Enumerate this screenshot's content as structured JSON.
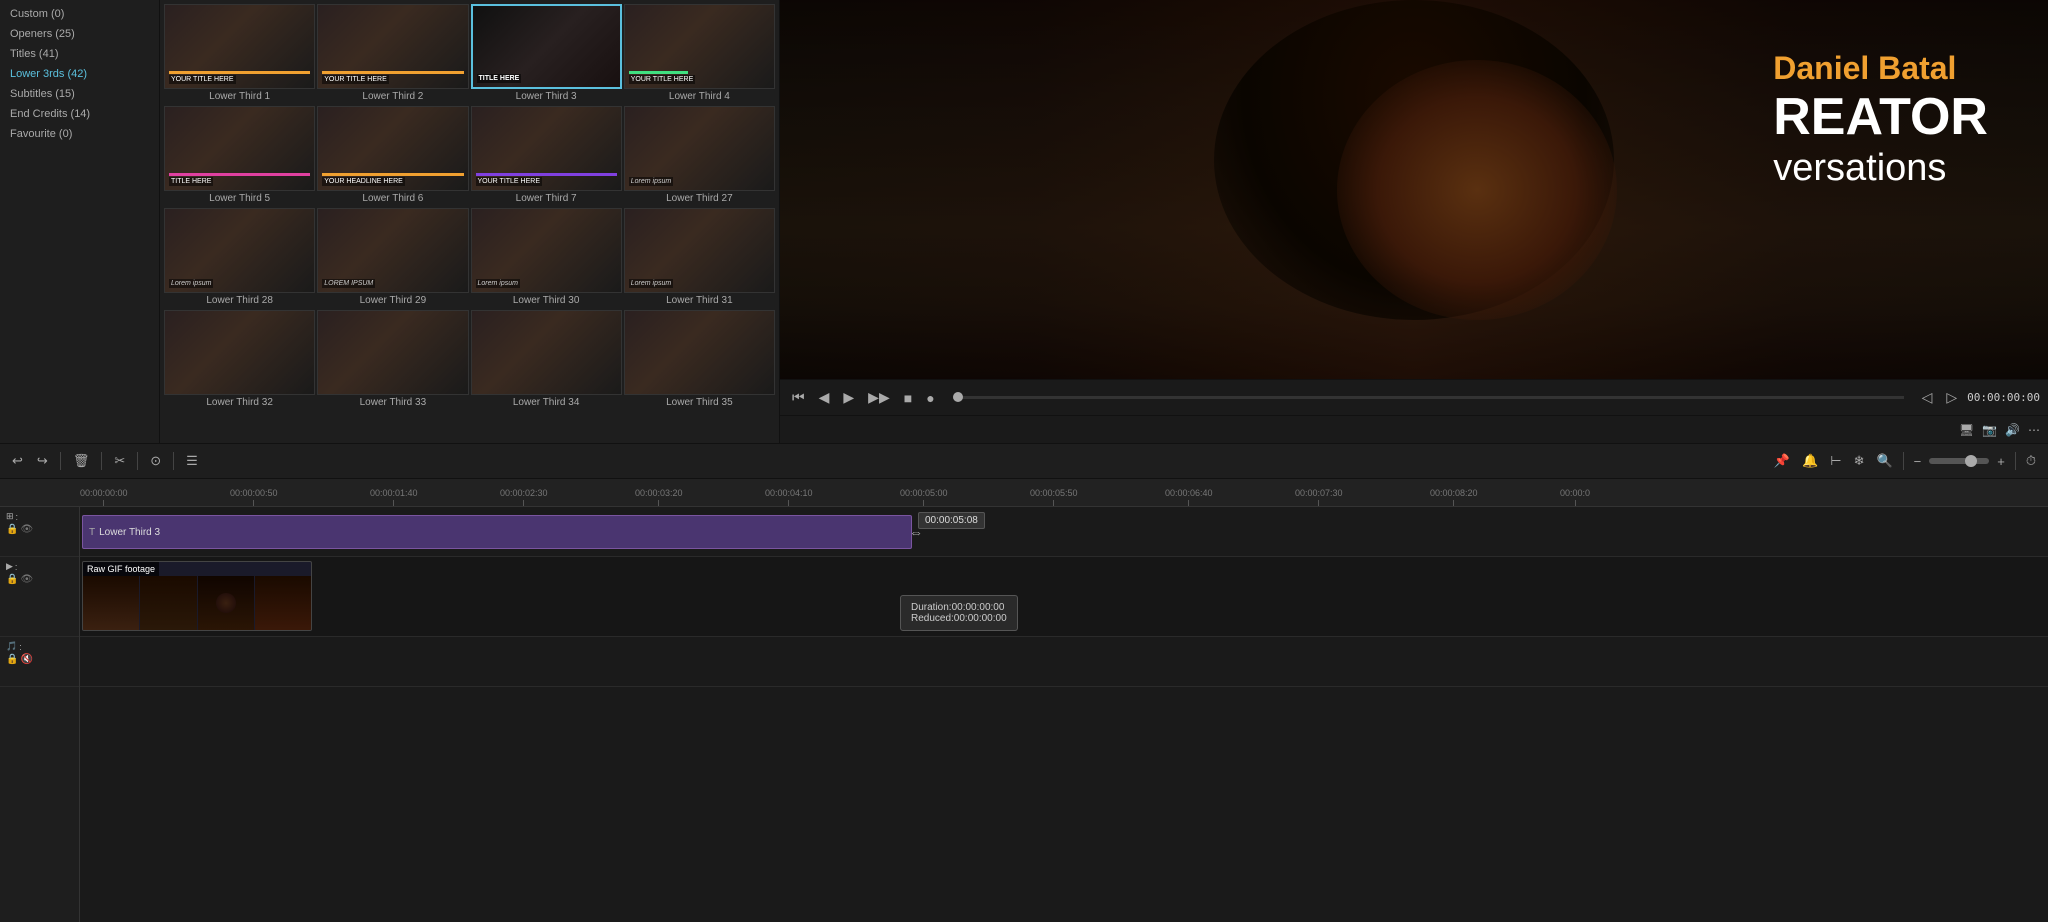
{
  "sidebar": {
    "items": [
      {
        "label": "Custom (0)",
        "active": false
      },
      {
        "label": "Openers (25)",
        "active": false
      },
      {
        "label": "Titles (41)",
        "active": false
      },
      {
        "label": "Lower 3rds (42)",
        "active": true
      },
      {
        "label": "Subtitles (15)",
        "active": false
      },
      {
        "label": "End Credits (14)",
        "active": false
      },
      {
        "label": "Favourite (0)",
        "active": false
      }
    ]
  },
  "templates": [
    {
      "name": "Lower Third 1",
      "selected": false,
      "bar": "yellow"
    },
    {
      "name": "Lower Third 2",
      "selected": false,
      "bar": "yellow"
    },
    {
      "name": "Lower Third 3",
      "selected": true,
      "bar": "white"
    },
    {
      "name": "Lower Third 4",
      "selected": false,
      "bar": "green"
    },
    {
      "name": "Lower Third 5",
      "selected": false,
      "bar": "pink"
    },
    {
      "name": "Lower Third 6",
      "selected": false,
      "bar": "yellow"
    },
    {
      "name": "Lower Third 7",
      "selected": false,
      "bar": "purple"
    },
    {
      "name": "Lower Third 27",
      "selected": false,
      "bar": "none"
    },
    {
      "name": "Lower Third 28",
      "selected": false,
      "bar": "none"
    },
    {
      "name": "Lower Third 29",
      "selected": false,
      "bar": "none"
    },
    {
      "name": "Lower Third 30",
      "selected": false,
      "bar": "none"
    },
    {
      "name": "Lower Third 31",
      "selected": false,
      "bar": "none"
    },
    {
      "name": "Lower Third 32",
      "selected": false,
      "bar": "none"
    },
    {
      "name": "Lower Third 33",
      "selected": false,
      "bar": "none"
    },
    {
      "name": "Lower Third 34",
      "selected": false,
      "bar": "none"
    },
    {
      "name": "Lower Third 35",
      "selected": false,
      "bar": "none"
    }
  ],
  "preview": {
    "name": "Daniel Batal",
    "title_part1": "REATOR",
    "subtitle": "versations",
    "timecode": "00:00:00:00"
  },
  "timeline": {
    "ruler_marks": [
      "00:00:00:00",
      "00:00:00:50",
      "00:00:01:40",
      "00:00:02:30",
      "00:00:03:20",
      "00:00:04:10",
      "00:00:05:00",
      "00:00:05:50",
      "00:00:06:40",
      "00:00:07:30",
      "00:00:08:20",
      "00:00:0"
    ],
    "lower_third_clip": {
      "label": "Lower Third 3",
      "duration_display": "00:00:05:08"
    },
    "video_clip": {
      "label": "Raw GIF footage"
    },
    "tooltip": {
      "duration": "Duration:00:00:00:00",
      "reduced": "Reduced:00:00:00:00"
    }
  },
  "toolbar": {
    "undo": "↩",
    "redo": "↪",
    "delete": "🗑",
    "cut": "✂",
    "history": "⊙",
    "properties": "☰"
  }
}
